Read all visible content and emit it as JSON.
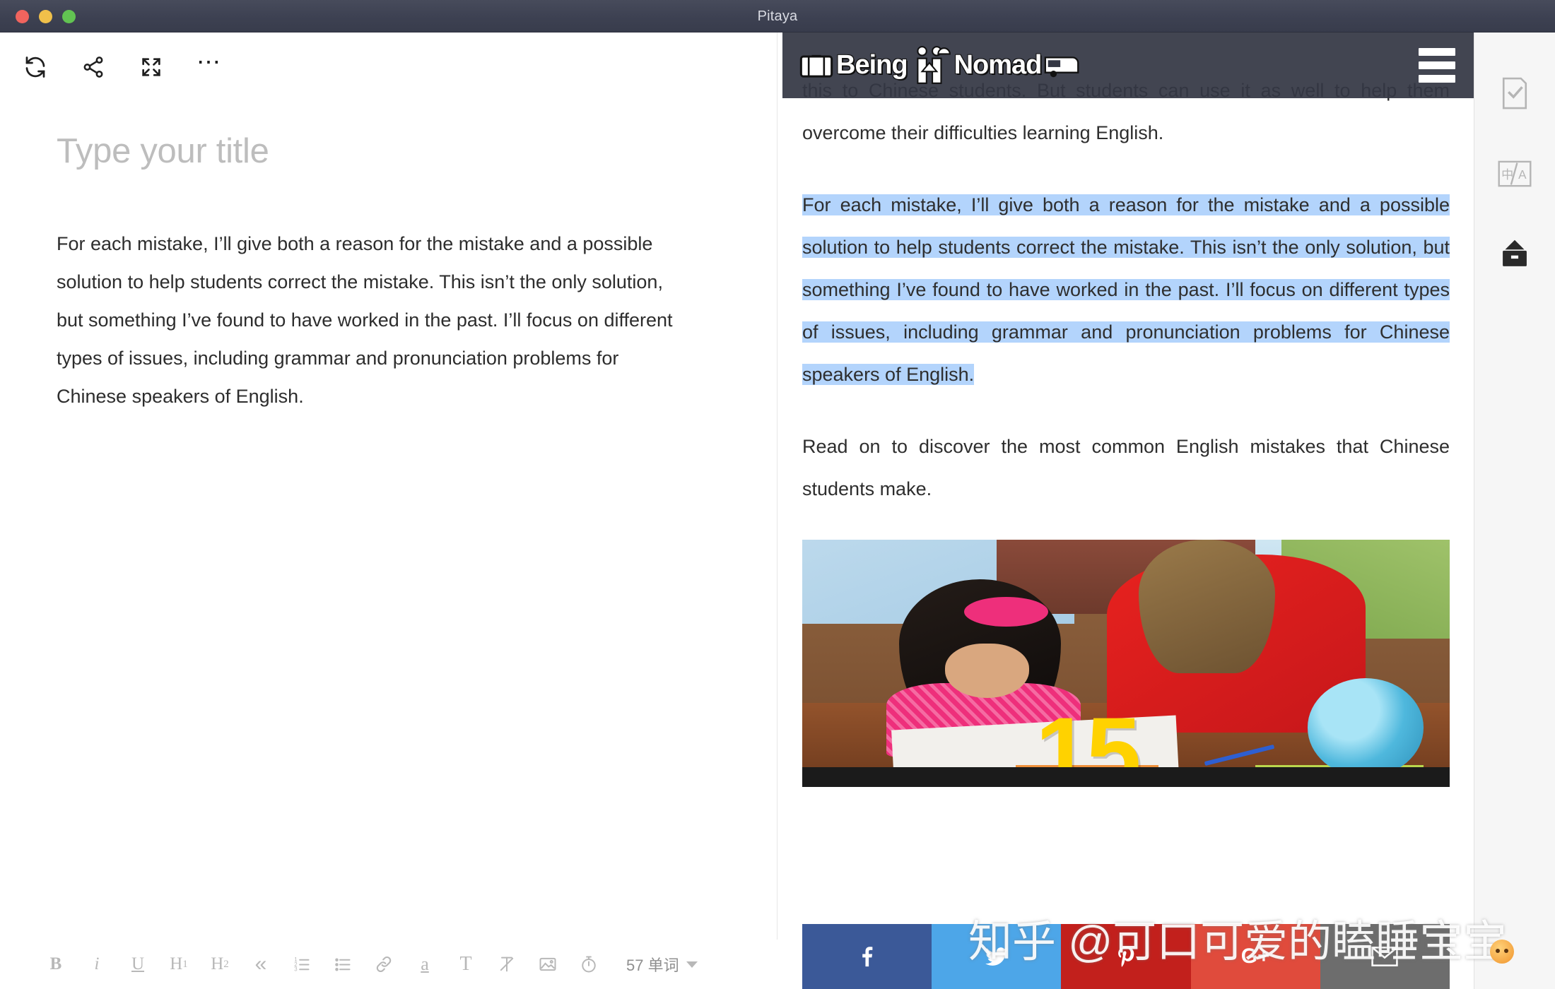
{
  "window": {
    "title": "Pitaya",
    "traffic_lights": [
      "close",
      "minimize",
      "maximize"
    ]
  },
  "editor": {
    "toolbar_top": [
      {
        "name": "sync-icon",
        "label": "Sync"
      },
      {
        "name": "share-icon",
        "label": "Share"
      },
      {
        "name": "fullscreen-icon",
        "label": "Fullscreen"
      },
      {
        "name": "more-icon",
        "label": "More"
      }
    ],
    "title_placeholder": "Type your title",
    "body": "For each mistake, I’ll give both a reason for the mistake and a possible solution to help students correct the mistake. This isn’t the only solution, but something I’ve found to have worked in the past. I’ll focus on different types of issues, including grammar and pronunciation problems for Chinese speakers of English.",
    "format_bar": {
      "bold": "B",
      "italic": "i",
      "underline": "U",
      "heading1": "H",
      "heading1_sub": "1",
      "heading2": "H",
      "heading2_sub": "2",
      "quote": "«",
      "ordered_list": "ordered-list-icon",
      "bullet_list": "bullet-list-icon",
      "link": "link-icon",
      "text_color": "a",
      "font": "T",
      "clear_format": "clear-format-icon",
      "image": "image-icon",
      "timer": "timer-icon",
      "word_count": "57 单词"
    }
  },
  "preview": {
    "site_header": {
      "logo_text_1": "Being",
      "logo_text_2": "Nomad",
      "menu": "hamburger-menu"
    },
    "paragraphs": [
      {
        "id": "p-intro",
        "text": "this to Chinese students. But students can use it as well to help them overcome their difficulties learning English.",
        "highlighted": false
      },
      {
        "id": "p-selected",
        "text": "For each mistake, I’ll give both a reason for the mistake and a possible solution to help students correct the mistake. This isn’t the only solution, but something I’ve found to have worked in the past. I’ll focus on different types of issues, including grammar and pronunciation problems for Chinese speakers of English.",
        "highlighted": true
      },
      {
        "id": "p-read-on",
        "text": "Read on to discover the most common English mistakes that Chinese students make.",
        "highlighted": false
      }
    ],
    "figure": {
      "alt": "Teacher helping a young girl with her homework at a desk",
      "overlay_number": "15"
    },
    "social_buttons": [
      {
        "name": "facebook-share-button",
        "label": "f",
        "color": "#3b5998"
      },
      {
        "name": "twitter-share-button",
        "label": "twitter-icon",
        "color": "#4da6e8"
      },
      {
        "name": "pinterest-share-button",
        "label": "pinterest-icon",
        "color": "#c2201c"
      },
      {
        "name": "googleplus-share-button",
        "label": "G+",
        "color": "#e04b3c"
      },
      {
        "name": "email-share-button",
        "label": "email-icon",
        "color": "#6d6d6d"
      }
    ]
  },
  "rail": {
    "items": [
      {
        "name": "task-check-icon",
        "label": "Check"
      },
      {
        "name": "translate-icon",
        "label": "中/A"
      },
      {
        "name": "archive-icon",
        "label": "Archive",
        "active": true
      }
    ]
  },
  "watermark": {
    "text": "知乎 @可口可爱的瞌睡宝宝"
  },
  "colors": {
    "titlebar": "#3d4152",
    "selection": "#b3d4fc",
    "site_header": "#343744",
    "rail_bg": "#f6f6f6"
  }
}
